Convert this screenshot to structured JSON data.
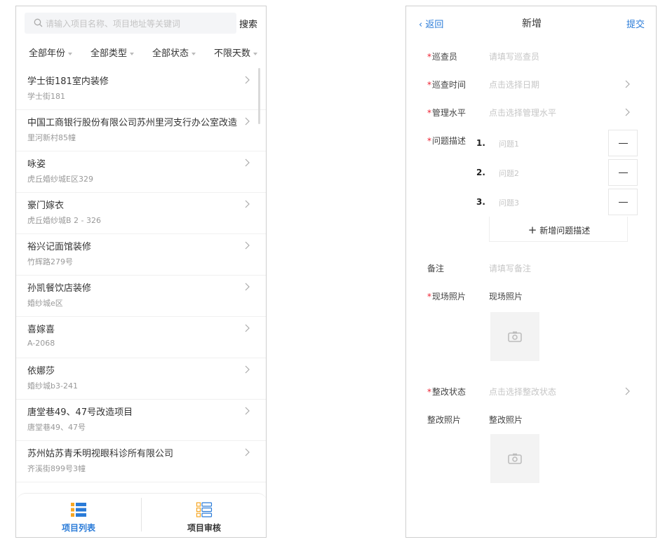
{
  "list_screen": {
    "search": {
      "placeholder": "请输入项目名称、项目地址等关键词",
      "button": "搜索"
    },
    "filters": [
      "全部年份",
      "全部类型",
      "全部状态",
      "不限天数"
    ],
    "items": [
      {
        "title": "学士街181室内装修",
        "address": "学士街181"
      },
      {
        "title": "中国工商银行股份有限公司苏州里河支行办公室改造",
        "address": "里河新村85幢"
      },
      {
        "title": "咏姿",
        "address": "虎丘婚纱城E区329"
      },
      {
        "title": "豪门嫁衣",
        "address": "虎丘婚纱城B 2 - 326"
      },
      {
        "title": "裕兴记面馆装修",
        "address": "竹辉路279号"
      },
      {
        "title": "孙凯餐饮店装修",
        "address": "婚纱城e区"
      },
      {
        "title": "喜嫁喜",
        "address": "A-2068"
      },
      {
        "title": "依娜莎",
        "address": "婚纱城b3-241"
      },
      {
        "title": "唐堂巷49、47号改造项目",
        "address": "唐堂巷49、47号"
      },
      {
        "title": "苏州姑苏青禾明视眼科诊所有限公司",
        "address": "齐溪街899号3幢"
      }
    ],
    "tabs": [
      {
        "label": "项目列表",
        "active": true
      },
      {
        "label": "项目审核",
        "active": false
      }
    ],
    "colors": {
      "accent": "#2a7bd8",
      "tab_icon_active": "#2a7bd8",
      "tab_icon_orange": "#f6a623"
    }
  },
  "form_screen": {
    "nav": {
      "back": "返回",
      "title": "新增",
      "submit": "提交"
    },
    "fields": {
      "inspector": {
        "label": "巡查员",
        "placeholder": "请填写巡查员"
      },
      "time": {
        "label": "巡查时间",
        "placeholder": "点击选择日期"
      },
      "level": {
        "label": "管理水平",
        "placeholder": "点击选择管理水平"
      },
      "issues": {
        "label": "问题描述",
        "add_label": "新增问题描述",
        "items": [
          {
            "num": "1.",
            "placeholder": "问题1"
          },
          {
            "num": "2.",
            "placeholder": "问题2"
          },
          {
            "num": "3.",
            "placeholder": "问题3"
          }
        ]
      },
      "remark": {
        "label": "备注",
        "placeholder": "请填写备注"
      },
      "site_photo": {
        "label": "现场照片",
        "value": "现场照片"
      },
      "rectify_status": {
        "label": "整改状态",
        "placeholder": "点击选择整改状态"
      },
      "rectify_photo": {
        "label": "整改照片",
        "value": "整改照片"
      }
    },
    "required_marker": "*"
  }
}
